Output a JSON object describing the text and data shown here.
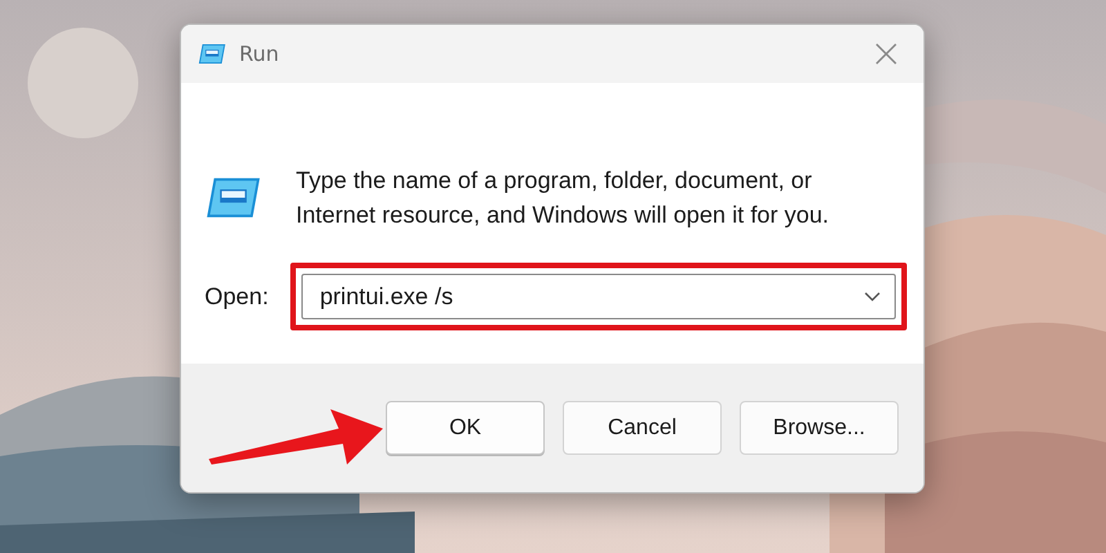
{
  "window": {
    "title": "Run"
  },
  "description": "Type the name of a program, folder, document, or Internet resource, and Windows will open it for you.",
  "open_field": {
    "label": "Open:",
    "value": "printui.exe /s"
  },
  "buttons": [
    {
      "label": "OK",
      "selected": true
    },
    {
      "label": "Cancel",
      "selected": false
    },
    {
      "label": "Browse...",
      "selected": false
    }
  ]
}
